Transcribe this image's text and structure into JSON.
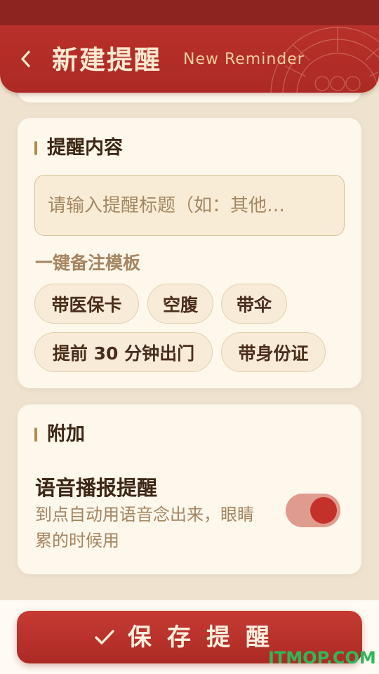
{
  "header": {
    "title": "新建提醒",
    "subtitle": "New Reminder"
  },
  "content_section": {
    "title": "提醒内容",
    "input_placeholder": "请输入提醒标题（如：其他…",
    "input_value": "",
    "template_label": "一键备注模板",
    "templates": [
      "带医保卡",
      "空腹",
      "带伞",
      "提前 30 分钟出门",
      "带身份证"
    ]
  },
  "extra_section": {
    "title": "附加",
    "voice_title": "语音播报提醒",
    "voice_desc": "到点自动用语音念出来，眼睛累的时候用",
    "voice_enabled": true
  },
  "save_button": {
    "label": "保存提醒"
  },
  "watermark": "ITMOP.COM",
  "icons": {
    "back": "back-chevron-icon",
    "check": "check-icon"
  },
  "colors": {
    "brand_red": "#b8302a",
    "accent_gold": "#b48a4e",
    "toggle_track": "#e09b8f",
    "toggle_knob": "#c4302a",
    "watermark": "#2fb85a"
  }
}
